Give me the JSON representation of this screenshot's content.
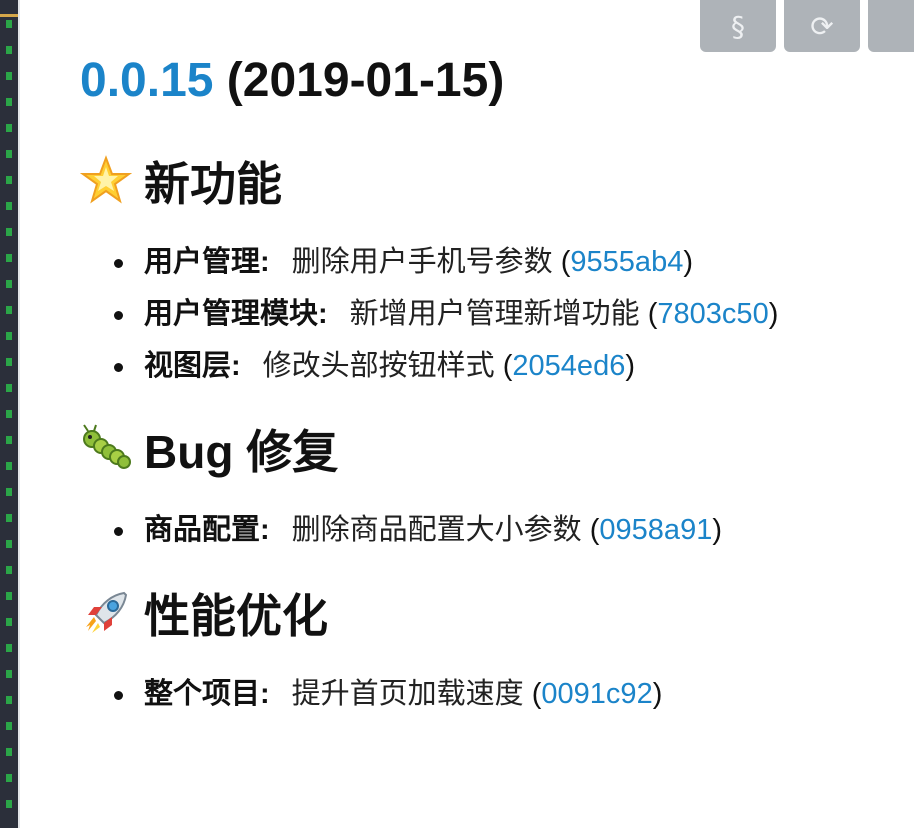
{
  "toolbar": {
    "anchor_symbol": "§",
    "refresh_symbol": "⟳"
  },
  "release": {
    "version": "0.0.15",
    "date": "(2019-01-15)"
  },
  "sections": {
    "features": {
      "emoji": "star-icon",
      "title": "新功能",
      "items": [
        {
          "scope": "用户管理:",
          "desc": "删除用户手机号参数",
          "hash": "9555ab4"
        },
        {
          "scope": "用户管理模块:",
          "desc": "新增用户管理新增功能",
          "hash": "7803c50"
        },
        {
          "scope": "视图层:",
          "desc": "修改头部按钮样式",
          "hash": "2054ed6"
        }
      ]
    },
    "bugfix": {
      "emoji": "bug-icon",
      "title": "Bug 修复",
      "items": [
        {
          "scope": "商品配置:",
          "desc": "删除商品配置大小参数",
          "hash": "0958a91"
        }
      ]
    },
    "perf": {
      "emoji": "rocket-icon",
      "title": "性能优化",
      "items": [
        {
          "scope": "整个项目:",
          "desc": "提升首页加载速度",
          "hash": "0091c92"
        }
      ]
    }
  },
  "colors": {
    "link": "#1b84c9",
    "toolbar_button": "#aeb3b8",
    "gutter": "#2b2f3a"
  }
}
